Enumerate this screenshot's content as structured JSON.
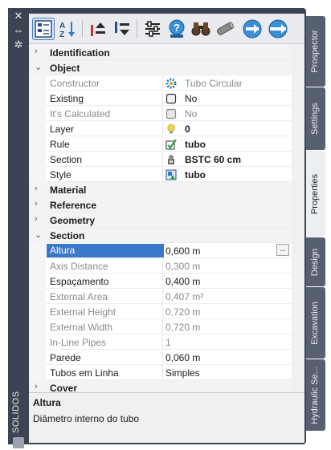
{
  "palette": {
    "vertical_title": "SOLIDOS"
  },
  "toolbar": {
    "buttons": [
      {
        "icon": "quick-select-list-icon",
        "active": true
      },
      {
        "icon": "sort-az-icon",
        "active": false
      },
      {
        "icon": "move-up-icon",
        "active": false
      },
      {
        "icon": "move-down-icon",
        "active": false
      },
      {
        "icon": "settings-sliders-icon",
        "active": false
      },
      {
        "icon": "help-icon",
        "active": false
      },
      {
        "icon": "binoculars-icon",
        "active": false
      },
      {
        "icon": "pipe-icon",
        "active": false
      },
      {
        "icon": "nav-right-icon",
        "active": false
      },
      {
        "icon": "nav-forward-icon",
        "active": false
      }
    ]
  },
  "grid": {
    "rows": [
      {
        "type": "category",
        "label": "Identification",
        "expanded": false
      },
      {
        "type": "category",
        "label": "Object",
        "expanded": true
      },
      {
        "type": "prop",
        "name": "Constructor",
        "value": "Tubo Circular",
        "readonly": true,
        "icon": "gear-icon",
        "bold": false
      },
      {
        "type": "prop",
        "name": "Existing",
        "value": "No",
        "readonly": false,
        "icon": "checkbox-icon",
        "bold": false
      },
      {
        "type": "prop",
        "name": "It's Calculated",
        "value": "No",
        "readonly": true,
        "icon": "checkbox-icon",
        "bold": false
      },
      {
        "type": "prop",
        "name": "Layer",
        "value": "0",
        "readonly": false,
        "icon": "lightbulb-icon",
        "bold": true
      },
      {
        "type": "prop",
        "name": "Rule",
        "value": "tubo",
        "readonly": false,
        "icon": "rule-check-icon",
        "bold": true
      },
      {
        "type": "prop",
        "name": "Section",
        "value": "BSTC 60 cm",
        "readonly": false,
        "icon": "section-icon",
        "bold": true
      },
      {
        "type": "prop",
        "name": "Style",
        "value": "tubo",
        "readonly": false,
        "icon": "style-icon",
        "bold": true
      },
      {
        "type": "category",
        "label": "Material",
        "expanded": false
      },
      {
        "type": "category",
        "label": "Reference",
        "expanded": false
      },
      {
        "type": "category",
        "label": "Geometry",
        "expanded": false
      },
      {
        "type": "category",
        "label": "Section",
        "expanded": true
      },
      {
        "type": "prop",
        "name": "Altura",
        "value": "0,600 m",
        "readonly": false,
        "selected": true,
        "ellipsis": "...",
        "bold": false
      },
      {
        "type": "prop",
        "name": "Axis Distance",
        "value": "0,300 m",
        "readonly": true,
        "bold": false
      },
      {
        "type": "prop",
        "name": "Espaçamento",
        "value": "0,400 m",
        "readonly": false,
        "bold": false
      },
      {
        "type": "prop",
        "name": "External Area",
        "value": "0,407 m²",
        "readonly": true,
        "bold": false
      },
      {
        "type": "prop",
        "name": "External Height",
        "value": "0,720 m",
        "readonly": true,
        "bold": false
      },
      {
        "type": "prop",
        "name": "External Width",
        "value": "0,720 m",
        "readonly": true,
        "bold": false
      },
      {
        "type": "prop",
        "name": "In-Line Pipes",
        "value": "1",
        "readonly": true,
        "bold": false
      },
      {
        "type": "prop",
        "name": "Parede",
        "value": "0,060 m",
        "readonly": false,
        "bold": false
      },
      {
        "type": "prop",
        "name": "Tubos em Linha",
        "value": "Simples",
        "readonly": false,
        "bold": false
      },
      {
        "type": "category",
        "label": "Cover",
        "expanded": false
      }
    ]
  },
  "description": {
    "title": "Altura",
    "text": "Diâmetro interno do tubo"
  },
  "tabs": [
    {
      "label": "Prospector",
      "active": false
    },
    {
      "label": "Settings",
      "active": false
    },
    {
      "label": "Properties",
      "active": true
    },
    {
      "label": "Design",
      "active": false
    },
    {
      "label": "Excavation",
      "active": false
    },
    {
      "label": "Hydraulic Se...",
      "active": false
    }
  ]
}
